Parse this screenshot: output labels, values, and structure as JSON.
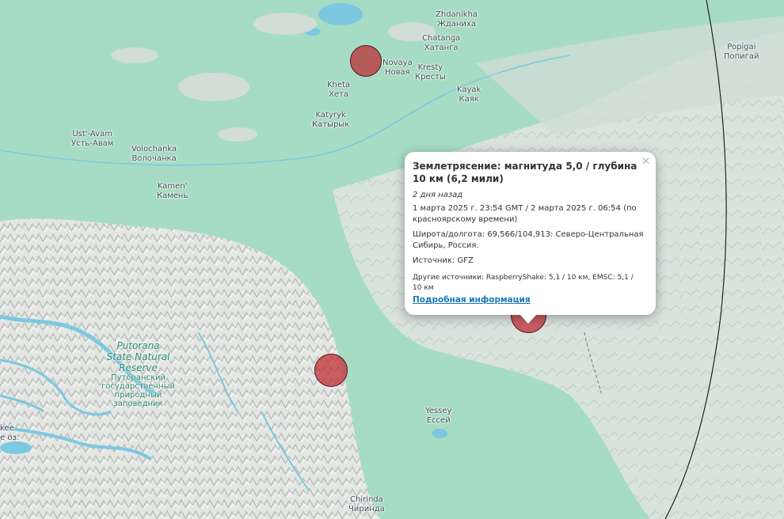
{
  "places": [
    {
      "id": "zhdanikha",
      "latin": "Zhdanikha",
      "cyr": "Жданиха"
    },
    {
      "id": "chatanga",
      "latin": "Chatanga",
      "cyr": "Хатанга"
    },
    {
      "id": "novaya",
      "latin": "Novaya",
      "cyr": "Новая"
    },
    {
      "id": "kresty",
      "latin": "Kresty",
      "cyr": "Кресты"
    },
    {
      "id": "kheta",
      "latin": "Kheta",
      "cyr": "Хета"
    },
    {
      "id": "kayak",
      "latin": "Kayak",
      "cyr": "Каяк"
    },
    {
      "id": "katyryk",
      "latin": "Katyryk",
      "cyr": "Катырык"
    },
    {
      "id": "popigai",
      "latin": "Popigai",
      "cyr": "Попигай"
    },
    {
      "id": "ust-avam",
      "latin": "Ust'-Avam",
      "cyr": "Усть-Авам"
    },
    {
      "id": "volochanka",
      "latin": "Volochanka",
      "cyr": "Волочанка"
    },
    {
      "id": "kamen",
      "latin": "Kamen'",
      "cyr": "Камень"
    },
    {
      "id": "yessey",
      "latin": "Yessey",
      "cyr": "Ессей"
    },
    {
      "id": "chirinda",
      "latin": "Chirinda",
      "cyr": "Чиринда"
    },
    {
      "id": "kee",
      "latin": "kee",
      "cyr": "е оз."
    }
  ],
  "reserve": {
    "en": [
      "Putorana",
      "State Natural",
      "Reserve"
    ],
    "ru": [
      "Путоранский",
      "государственный",
      "природный",
      "заповедник"
    ]
  },
  "popup": {
    "close": "×",
    "title": "Землетрясение: магнитуда 5,0 / глубина 10 км (6,2 мили)",
    "ago": "2 дня назад",
    "time": "1 марта 2025 г. 23:54 GMT / 2 марта 2025 г. 06:54 (по красноярскому времени)",
    "coords": "Широта/долгота: 69,566/104,913: Северо-Центральная Сибирь, Россия.",
    "source": "Источник: GFZ",
    "other": "Другие источники: RaspberryShake: 5,1 / 10 км, EMSC: 5,1 / 10 км",
    "more": "Подробная информация"
  }
}
